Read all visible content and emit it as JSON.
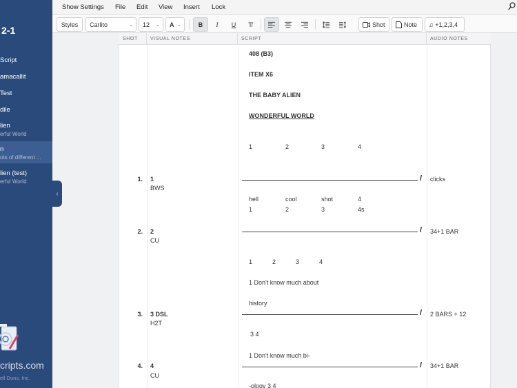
{
  "sidebar": {
    "project_title": "2-1",
    "items": [
      {
        "title": "Script",
        "subtitle": ""
      },
      {
        "title": "amacallit",
        "subtitle": ""
      },
      {
        "title": " Test",
        "subtitle": ""
      },
      {
        "title": "dile",
        "subtitle": ""
      },
      {
        "title": "lien",
        "subtitle": "erful World"
      },
      {
        "title": "n",
        "subtitle": "ots of different ..."
      },
      {
        "title": "lien (test)",
        "subtitle": "erful World"
      }
    ],
    "brand": "cripts.com",
    "copyright": "ell Duns, Inc."
  },
  "menu": {
    "items": [
      "Show Settings",
      "File",
      "Edit",
      "View",
      "Insert",
      "Lock"
    ]
  },
  "toolbar": {
    "styles": "Styles",
    "font": "Carlito",
    "size": "12",
    "font_color": "A",
    "bold": "B",
    "italic": "I",
    "underline": "U",
    "clear_format": "T̸",
    "shot": "Shot",
    "note": "Note",
    "beats": "♫ +1,2,3,4"
  },
  "columns": {
    "shot": "SHOT",
    "visual": "VISUAL NOTES",
    "script": "SCRIPT",
    "audio": "AUDIO NOTES"
  },
  "script_header": {
    "line1": "408 (B3)",
    "line2": "ITEM X6",
    "line3": "THE BABY ALIEN",
    "line4": "WONDERFUL WORLD",
    "counts": [
      "1",
      "2",
      "3",
      "4"
    ]
  },
  "shots": [
    {
      "num": "1.",
      "visual_title": "1",
      "visual_sub": "BWS",
      "audio": "clicks"
    },
    {
      "num": "2.",
      "visual_title": "2",
      "visual_sub": "CU",
      "audio": "34+1 BAR"
    },
    {
      "num": "3.",
      "visual_title": "3 DSL",
      "visual_sub": "H2T",
      "audio": "2 BARS + 12"
    },
    {
      "num": "4.",
      "visual_title": "4",
      "visual_sub": "CU",
      "audio": "34+1 BAR"
    }
  ],
  "script_lines": {
    "shot1_words": [
      "hell",
      "cool",
      "shot",
      "4"
    ],
    "shot1_counts": [
      "1",
      "2",
      "3",
      "4s"
    ],
    "shot2_counts": [
      "1",
      "2",
      "3",
      "4"
    ],
    "shot2_line1": "1 Don't know much about",
    "shot2_line2": "history",
    "shot3_counts": "3 4",
    "shot3_line1": "1 Don't know much bi-",
    "shot4_line1": "-ology 3 4"
  },
  "rule_slash": "/"
}
